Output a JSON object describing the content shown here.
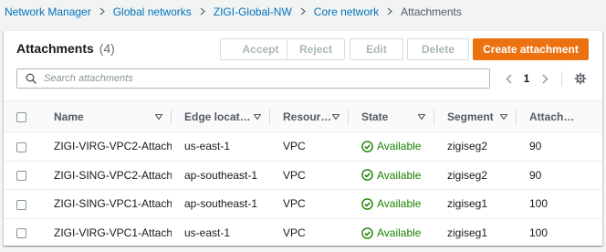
{
  "breadcrumb": [
    {
      "label": "Network Manager"
    },
    {
      "label": "Global networks"
    },
    {
      "label": "ZIGI-Global-NW"
    },
    {
      "label": "Core network"
    },
    {
      "label": "Attachments"
    }
  ],
  "panel": {
    "title": "Attachments",
    "count": "(4)"
  },
  "actions": {
    "accept": "Accept",
    "reject": "Reject",
    "edit": "Edit",
    "delete": "Delete",
    "create": "Create attachment"
  },
  "search": {
    "placeholder": "Search attachments"
  },
  "pagination": {
    "current_page": "1"
  },
  "table": {
    "columns": [
      "Name",
      "Edge locat…",
      "Resour…",
      "State",
      "Segment",
      "Attach…"
    ],
    "rows": [
      {
        "name": "ZIGI-VIRG-VPC2-Attach",
        "edge": "us-east-1",
        "resource": "VPC",
        "state": "Available",
        "segment": "zigiseg2",
        "attach": "90"
      },
      {
        "name": "ZIGI-SING-VPC2-Attach",
        "edge": "ap-southeast-1",
        "resource": "VPC",
        "state": "Available",
        "segment": "zigiseg2",
        "attach": "90"
      },
      {
        "name": "ZIGI-SING-VPC1-Attach",
        "edge": "ap-southeast-1",
        "resource": "VPC",
        "state": "Available",
        "segment": "zigiseg1",
        "attach": "100"
      },
      {
        "name": "ZIGI-VIRG-VPC1-Attach",
        "edge": "us-east-1",
        "resource": "VPC",
        "state": "Available",
        "segment": "zigiseg1",
        "attach": "100"
      }
    ]
  },
  "colors": {
    "primary": "#ec7211",
    "link": "#0073bb",
    "success": "#1d8102",
    "disabled": "#aab7b8"
  },
  "icons": {
    "search": "search-icon",
    "prev": "chevron-left-icon",
    "next": "chevron-right-icon",
    "settings": "gear-icon",
    "sort": "caret-down-icon",
    "status": "check-circle-icon",
    "separator": "chevron-right-icon"
  }
}
